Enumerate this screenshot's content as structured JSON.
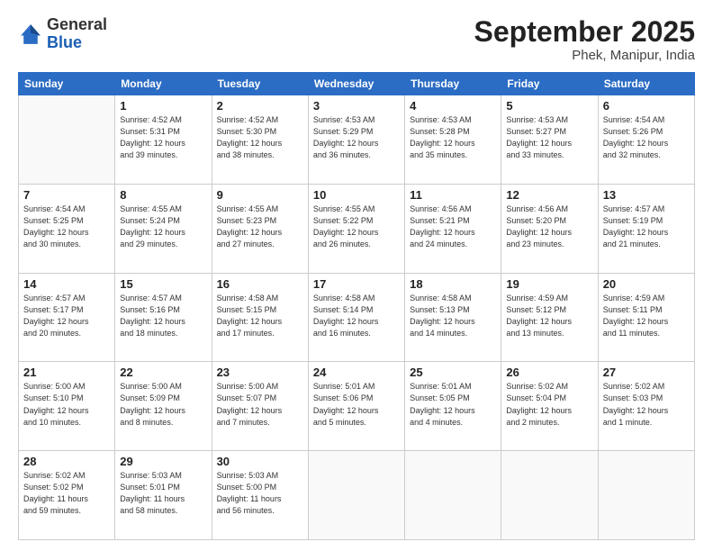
{
  "header": {
    "logo_general": "General",
    "logo_blue": "Blue",
    "month_title": "September 2025",
    "subtitle": "Phek, Manipur, India"
  },
  "columns": [
    "Sunday",
    "Monday",
    "Tuesday",
    "Wednesday",
    "Thursday",
    "Friday",
    "Saturday"
  ],
  "weeks": [
    [
      {
        "day": "",
        "info": ""
      },
      {
        "day": "1",
        "info": "Sunrise: 4:52 AM\nSunset: 5:31 PM\nDaylight: 12 hours\nand 39 minutes."
      },
      {
        "day": "2",
        "info": "Sunrise: 4:52 AM\nSunset: 5:30 PM\nDaylight: 12 hours\nand 38 minutes."
      },
      {
        "day": "3",
        "info": "Sunrise: 4:53 AM\nSunset: 5:29 PM\nDaylight: 12 hours\nand 36 minutes."
      },
      {
        "day": "4",
        "info": "Sunrise: 4:53 AM\nSunset: 5:28 PM\nDaylight: 12 hours\nand 35 minutes."
      },
      {
        "day": "5",
        "info": "Sunrise: 4:53 AM\nSunset: 5:27 PM\nDaylight: 12 hours\nand 33 minutes."
      },
      {
        "day": "6",
        "info": "Sunrise: 4:54 AM\nSunset: 5:26 PM\nDaylight: 12 hours\nand 32 minutes."
      }
    ],
    [
      {
        "day": "7",
        "info": "Sunrise: 4:54 AM\nSunset: 5:25 PM\nDaylight: 12 hours\nand 30 minutes."
      },
      {
        "day": "8",
        "info": "Sunrise: 4:55 AM\nSunset: 5:24 PM\nDaylight: 12 hours\nand 29 minutes."
      },
      {
        "day": "9",
        "info": "Sunrise: 4:55 AM\nSunset: 5:23 PM\nDaylight: 12 hours\nand 27 minutes."
      },
      {
        "day": "10",
        "info": "Sunrise: 4:55 AM\nSunset: 5:22 PM\nDaylight: 12 hours\nand 26 minutes."
      },
      {
        "day": "11",
        "info": "Sunrise: 4:56 AM\nSunset: 5:21 PM\nDaylight: 12 hours\nand 24 minutes."
      },
      {
        "day": "12",
        "info": "Sunrise: 4:56 AM\nSunset: 5:20 PM\nDaylight: 12 hours\nand 23 minutes."
      },
      {
        "day": "13",
        "info": "Sunrise: 4:57 AM\nSunset: 5:19 PM\nDaylight: 12 hours\nand 21 minutes."
      }
    ],
    [
      {
        "day": "14",
        "info": "Sunrise: 4:57 AM\nSunset: 5:17 PM\nDaylight: 12 hours\nand 20 minutes."
      },
      {
        "day": "15",
        "info": "Sunrise: 4:57 AM\nSunset: 5:16 PM\nDaylight: 12 hours\nand 18 minutes."
      },
      {
        "day": "16",
        "info": "Sunrise: 4:58 AM\nSunset: 5:15 PM\nDaylight: 12 hours\nand 17 minutes."
      },
      {
        "day": "17",
        "info": "Sunrise: 4:58 AM\nSunset: 5:14 PM\nDaylight: 12 hours\nand 16 minutes."
      },
      {
        "day": "18",
        "info": "Sunrise: 4:58 AM\nSunset: 5:13 PM\nDaylight: 12 hours\nand 14 minutes."
      },
      {
        "day": "19",
        "info": "Sunrise: 4:59 AM\nSunset: 5:12 PM\nDaylight: 12 hours\nand 13 minutes."
      },
      {
        "day": "20",
        "info": "Sunrise: 4:59 AM\nSunset: 5:11 PM\nDaylight: 12 hours\nand 11 minutes."
      }
    ],
    [
      {
        "day": "21",
        "info": "Sunrise: 5:00 AM\nSunset: 5:10 PM\nDaylight: 12 hours\nand 10 minutes."
      },
      {
        "day": "22",
        "info": "Sunrise: 5:00 AM\nSunset: 5:09 PM\nDaylight: 12 hours\nand 8 minutes."
      },
      {
        "day": "23",
        "info": "Sunrise: 5:00 AM\nSunset: 5:07 PM\nDaylight: 12 hours\nand 7 minutes."
      },
      {
        "day": "24",
        "info": "Sunrise: 5:01 AM\nSunset: 5:06 PM\nDaylight: 12 hours\nand 5 minutes."
      },
      {
        "day": "25",
        "info": "Sunrise: 5:01 AM\nSunset: 5:05 PM\nDaylight: 12 hours\nand 4 minutes."
      },
      {
        "day": "26",
        "info": "Sunrise: 5:02 AM\nSunset: 5:04 PM\nDaylight: 12 hours\nand 2 minutes."
      },
      {
        "day": "27",
        "info": "Sunrise: 5:02 AM\nSunset: 5:03 PM\nDaylight: 12 hours\nand 1 minute."
      }
    ],
    [
      {
        "day": "28",
        "info": "Sunrise: 5:02 AM\nSunset: 5:02 PM\nDaylight: 11 hours\nand 59 minutes."
      },
      {
        "day": "29",
        "info": "Sunrise: 5:03 AM\nSunset: 5:01 PM\nDaylight: 11 hours\nand 58 minutes."
      },
      {
        "day": "30",
        "info": "Sunrise: 5:03 AM\nSunset: 5:00 PM\nDaylight: 11 hours\nand 56 minutes."
      },
      {
        "day": "",
        "info": ""
      },
      {
        "day": "",
        "info": ""
      },
      {
        "day": "",
        "info": ""
      },
      {
        "day": "",
        "info": ""
      }
    ]
  ]
}
